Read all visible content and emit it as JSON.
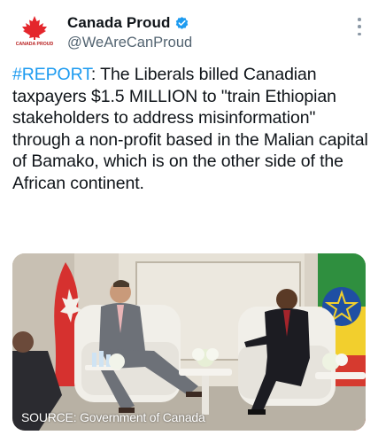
{
  "account": {
    "display_name": "Canada Proud",
    "handle": "@WeAreCanProud",
    "avatar_text": "CANADA PROUD",
    "verified": true
  },
  "tweet": {
    "hashtag": "#REPORT",
    "body": ": The Liberals billed Canadian taxpayers $1.5 MILLION to \"train Ethiopian stakeholders to address misinformation\" through a non-profit based in the Malian capital of Bamako, which is on the other side of the African continent."
  },
  "media": {
    "caption": "SOURCE: Government of Canada"
  },
  "colors": {
    "link": "#1d9bf0",
    "verified_badge": "#1d9bf0",
    "maple": "#e4262c",
    "secondary_text": "#536471"
  },
  "icons": {
    "verified": "verified-badge-icon",
    "more": "more-options-icon"
  }
}
